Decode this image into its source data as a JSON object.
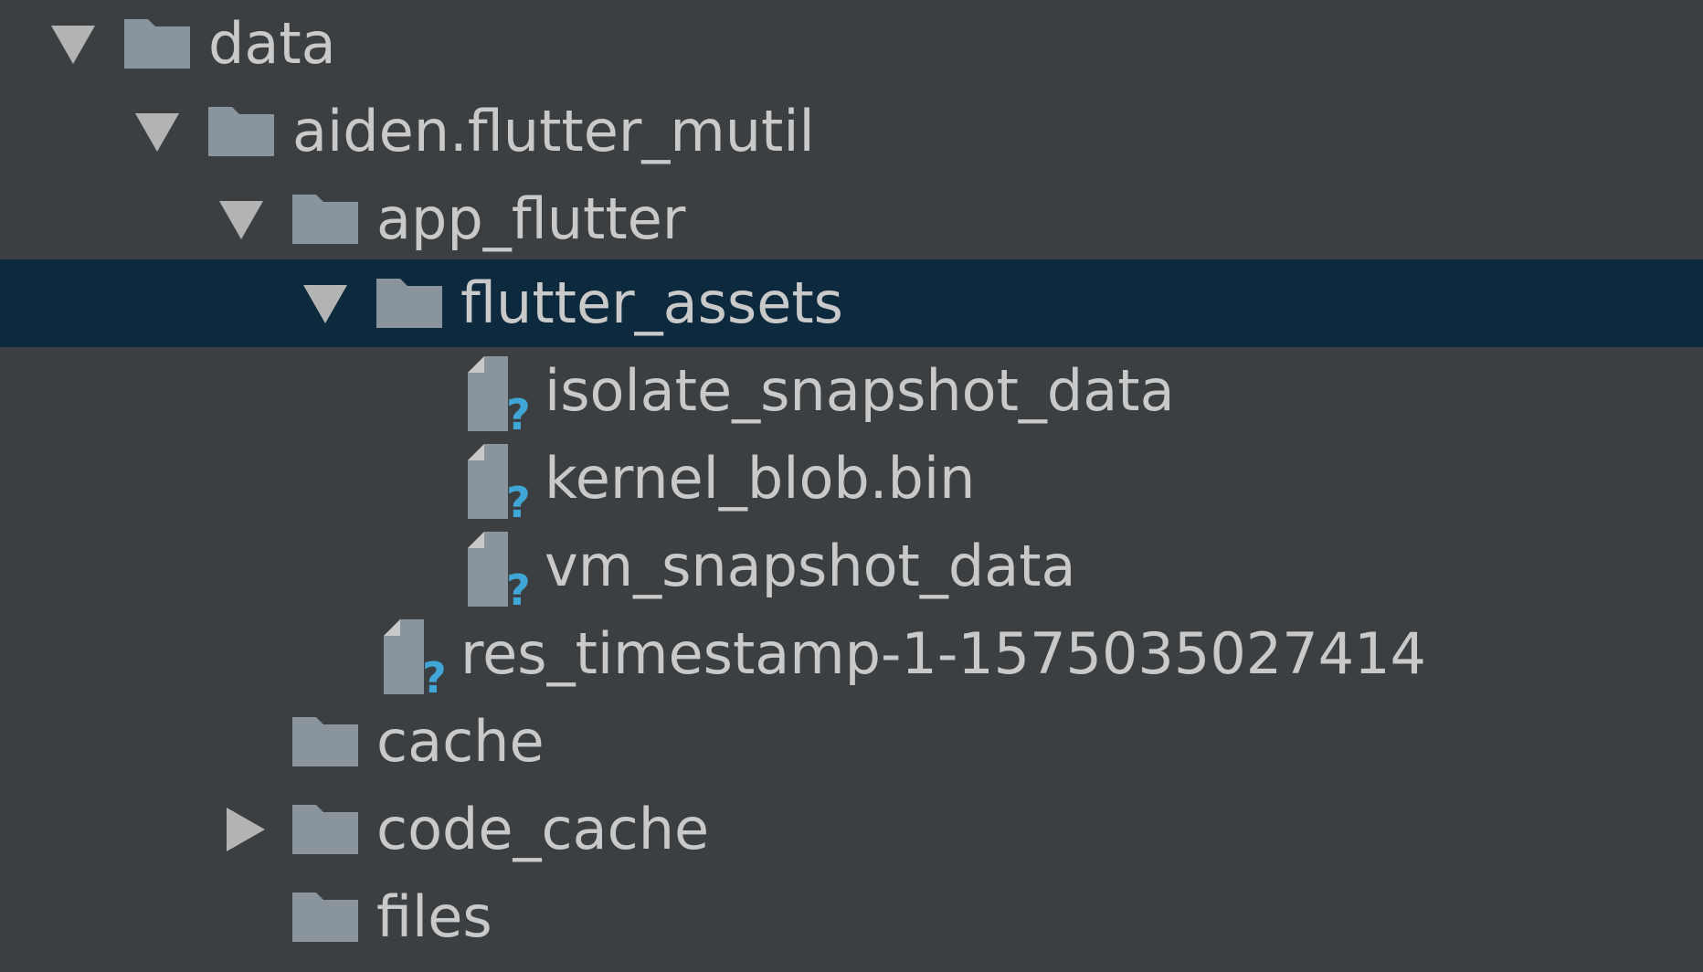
{
  "tree": {
    "nodes": [
      {
        "label": "data",
        "type": "folder",
        "expanded": true,
        "icon": "folder-icon",
        "toggle": "expanded-arrow-icon"
      },
      {
        "label": "aiden.flutter_mutil",
        "type": "folder",
        "expanded": true,
        "icon": "folder-icon",
        "toggle": "expanded-arrow-icon"
      },
      {
        "label": "app_flutter",
        "type": "folder",
        "expanded": true,
        "icon": "folder-icon",
        "toggle": "expanded-arrow-icon"
      },
      {
        "label": "flutter_assets",
        "type": "folder",
        "expanded": true,
        "selected": true,
        "icon": "folder-icon",
        "toggle": "expanded-arrow-icon"
      },
      {
        "label": "isolate_snapshot_data",
        "type": "file",
        "icon": "unknown-file-icon"
      },
      {
        "label": "kernel_blob.bin",
        "type": "file",
        "icon": "unknown-file-icon"
      },
      {
        "label": "vm_snapshot_data",
        "type": "file",
        "icon": "unknown-file-icon"
      },
      {
        "label": "res_timestamp-1-1575035027414",
        "type": "file",
        "icon": "unknown-file-icon"
      },
      {
        "label": "cache",
        "type": "folder",
        "icon": "folder-icon"
      },
      {
        "label": "code_cache",
        "type": "folder",
        "expanded": false,
        "icon": "folder-icon",
        "toggle": "collapsed-arrow-icon"
      },
      {
        "label": "files",
        "type": "folder",
        "icon": "folder-icon"
      }
    ]
  },
  "colors": {
    "background": "#3c3f41",
    "selection": "#0d293e",
    "text": "#c9c9c9",
    "icon": "#8a949c",
    "arrow": "#b3b3b3",
    "unknown_mark": "#40a6d8"
  }
}
